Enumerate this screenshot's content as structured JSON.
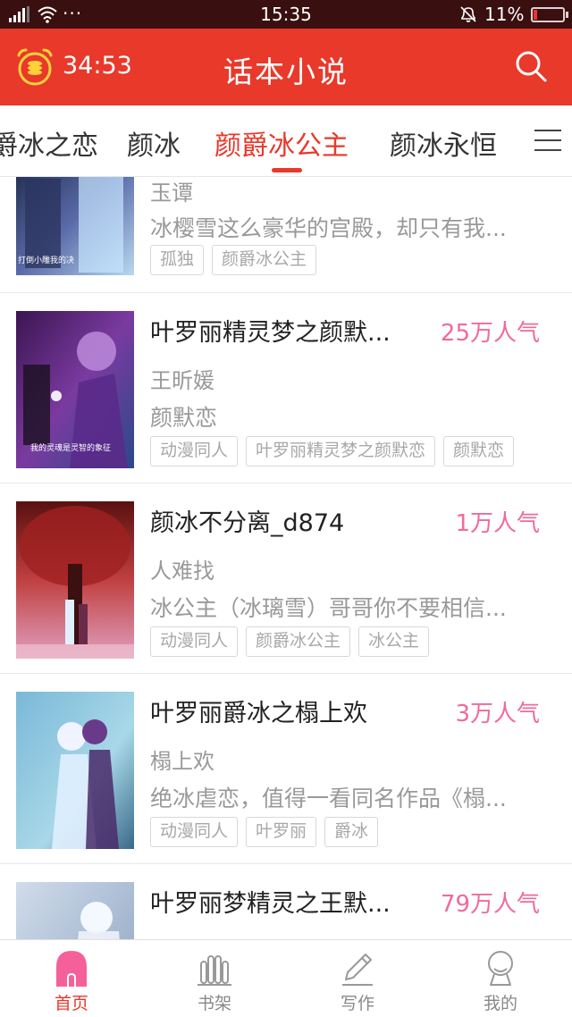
{
  "status_bar": {
    "dots": "···",
    "time": "15:35",
    "battery": "11%",
    "battery_level": 0.11
  },
  "header": {
    "timer": "34:53",
    "title": "话本小说",
    "accent_color": "#e8392b"
  },
  "tabs": [
    {
      "label": "爵冰之恋"
    },
    {
      "label": "颜冰"
    },
    {
      "label": "颜爵冰公主",
      "active": true
    },
    {
      "label": "颜冰永恒"
    }
  ],
  "books": [
    {
      "title": "",
      "popularity": "",
      "author": "玉谭",
      "desc": "冰樱雪这么豪华的宫殿，却只有我...",
      "tags": [
        "孤独",
        "颜爵冰公主"
      ],
      "cover_caption": "打倒小雕我的决"
    },
    {
      "title": "叶罗丽精灵梦之颜默...",
      "popularity": "25万人气",
      "author": "王昕媛",
      "desc": "颜默恋",
      "tags": [
        "动漫同人",
        "叶罗丽精灵梦之颜默恋",
        "颜默恋"
      ],
      "cover_caption": "我的灵魂是灵智的象征"
    },
    {
      "title": "颜冰不分离_d874",
      "popularity": "1万人气",
      "author": "人难找",
      "desc": "冰公主（冰璃雪）哥哥你不要相信...",
      "tags": [
        "动漫同人",
        "颜爵冰公主",
        "冰公主"
      ]
    },
    {
      "title": "叶罗丽爵冰之榻上欢",
      "popularity": "3万人气",
      "author": "榻上欢",
      "desc": "绝冰虐恋，值得一看同名作品《榻...",
      "tags": [
        "动漫同人",
        "叶罗丽",
        "爵冰"
      ]
    },
    {
      "title": "叶罗丽梦精灵之王默...",
      "popularity": "79万人气",
      "author": "",
      "desc": "",
      "tags": []
    }
  ],
  "bottom_nav": [
    {
      "label": "首页",
      "icon": "home-icon",
      "active": true
    },
    {
      "label": "书架",
      "icon": "bookshelf-icon"
    },
    {
      "label": "写作",
      "icon": "pen-icon"
    },
    {
      "label": "我的",
      "icon": "profile-icon"
    }
  ]
}
